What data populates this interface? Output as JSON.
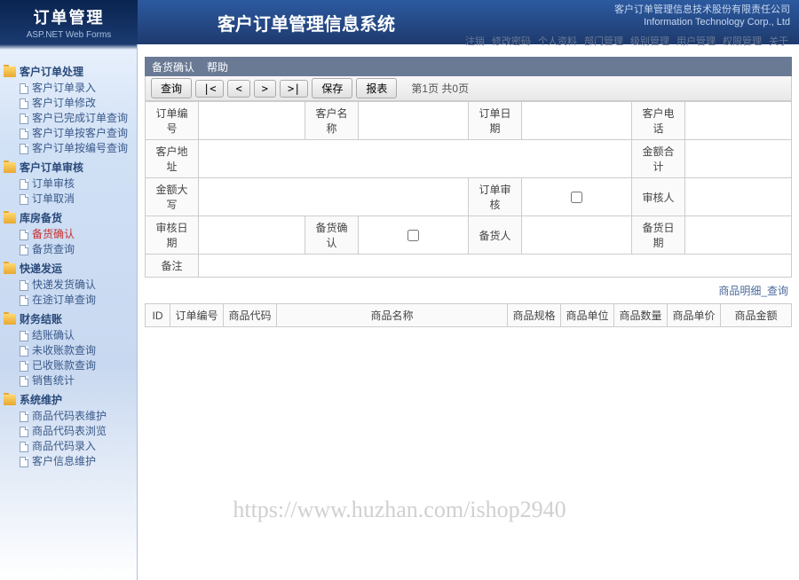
{
  "header": {
    "logo_title": "订单管理",
    "logo_sub": "ASP.NET Web Forms",
    "sys_title": "客户订单管理信息系统",
    "corp_line1": "客户订单管理信息技术股份有限责任公司",
    "corp_line2": "Information Technology Corp., Ltd"
  },
  "topnav": [
    "注销",
    "修改密码",
    "个人资料",
    "部门管理",
    "级别管理",
    "用户管理",
    "权限管理",
    "关于"
  ],
  "sidebar": [
    {
      "title": "客户订单处理",
      "items": [
        "客户订单录入",
        "客户订单修改",
        "客户已完成订单查询",
        "客户订单按客户查询",
        "客户订单按编号查询"
      ]
    },
    {
      "title": "客户订单审核",
      "items": [
        "订单审核",
        "订单取消"
      ]
    },
    {
      "title": "库房备货",
      "items": [
        "备货确认",
        "备货查询"
      ],
      "activeIndex": 0
    },
    {
      "title": "快递发运",
      "items": [
        "快递发货确认",
        "在途订单查询"
      ]
    },
    {
      "title": "财务结账",
      "items": [
        "结账确认",
        "未收账款查询",
        "已收账款查询",
        "销售统计"
      ]
    },
    {
      "title": "系统维护",
      "items": [
        "商品代码表维护",
        "商品代码表浏览",
        "商品代码录入",
        "客户信息维护"
      ]
    }
  ],
  "tabbar": {
    "title": "备货确认",
    "help": "帮助"
  },
  "toolbar": {
    "query": "查询",
    "first": "|<",
    "prev": "<",
    "next": ">",
    "last": ">|",
    "save": "保存",
    "report": "报表",
    "page_info": "第1页 共0页"
  },
  "form": {
    "order_no": "订单编号",
    "cust_name": "客户名称",
    "order_date": "订单日期",
    "cust_phone": "客户电话",
    "cust_addr": "客户地址",
    "amount_total": "金额合计",
    "amount_cn": "金额大写",
    "order_review": "订单审核",
    "reviewer": "审核人",
    "review_date": "审核日期",
    "stock_confirm": "备货确认",
    "stock_person": "备货人",
    "stock_date": "备货日期",
    "remark": "备注"
  },
  "detail": {
    "bar": "商品明细_查询",
    "headers": [
      "ID",
      "订单编号",
      "商品代码",
      "商品名称",
      "商品规格",
      "商品单位",
      "商品数量",
      "商品单价",
      "商品金额"
    ]
  },
  "watermark": "https://www.huzhan.com/ishop2940"
}
